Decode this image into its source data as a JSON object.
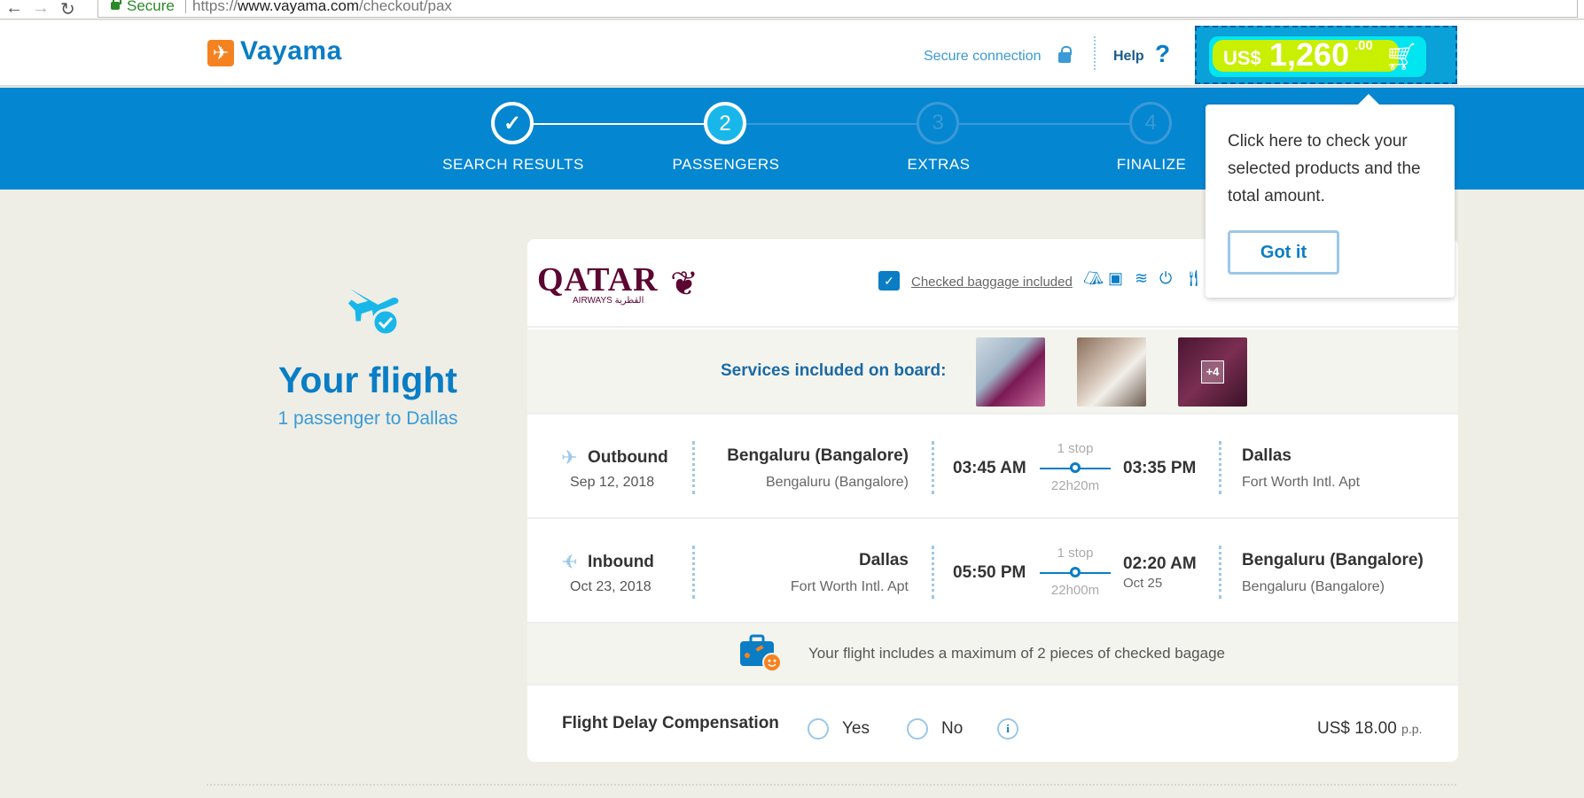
{
  "browser": {
    "back": "←",
    "forward": "→",
    "reload": "↻",
    "secure_label": "Secure",
    "url_scheme": "https://",
    "url_host": "www.vayama.com",
    "url_path": "/checkout/pax"
  },
  "header": {
    "logo": "Vayama",
    "secure_connection": "Secure connection",
    "help": "Help",
    "help_mark": "?",
    "cart": {
      "currency": "US$",
      "amount": "1,260",
      "cents": ".00"
    }
  },
  "steps": [
    {
      "label": "SEARCH RESULTS",
      "num": "✓",
      "state": "done"
    },
    {
      "label": "PASSENGERS",
      "num": "2",
      "state": "active"
    },
    {
      "label": "EXTRAS",
      "num": "3",
      "state": "pending"
    },
    {
      "label": "FINALIZE",
      "num": "4",
      "state": "pending"
    }
  ],
  "tooltip": {
    "text": "Click here to check your selected products and the total amount.",
    "button": "Got it"
  },
  "summary": {
    "title": "Your flight",
    "subtitle": "1 passenger to Dallas"
  },
  "airline": {
    "name": "QATAR",
    "sub": "AIRWAYS القطرية",
    "baggage_link": "Checked baggage included"
  },
  "services": {
    "label": "Services included on board:",
    "more": "+4"
  },
  "legs": [
    {
      "direction": "Outbound",
      "date": "Sep 12, 2018",
      "origin": "Bengaluru (Bangalore)",
      "origin_sub": "Bengaluru (Bangalore)",
      "depart": "03:45 AM",
      "stops": "1 stop",
      "duration": "22h20m",
      "arrive": "03:35 PM",
      "arrive_date": "",
      "dest": "Dallas",
      "dest_sub": "Fort Worth Intl. Apt"
    },
    {
      "direction": "Inbound",
      "date": "Oct 23, 2018",
      "origin": "Dallas",
      "origin_sub": "Fort Worth Intl. Apt",
      "depart": "05:50 PM",
      "stops": "1 stop",
      "duration": "22h00m",
      "arrive": "02:20 AM",
      "arrive_date": "Oct 25",
      "dest": "Bengaluru (Bangalore)",
      "dest_sub": "Bengaluru (Bangalore)"
    }
  ],
  "baggage_note": "Your flight includes a maximum of 2 pieces of checked bagage",
  "delay": {
    "label": "Flight Delay Compensation",
    "yes": "Yes",
    "no": "No",
    "info": "i",
    "price": "US$ 18.00",
    "pp": "p.p."
  },
  "colors": {
    "brand_blue": "#0586d1",
    "accent_orange": "#f58220",
    "qatar_maroon": "#5c0632"
  }
}
